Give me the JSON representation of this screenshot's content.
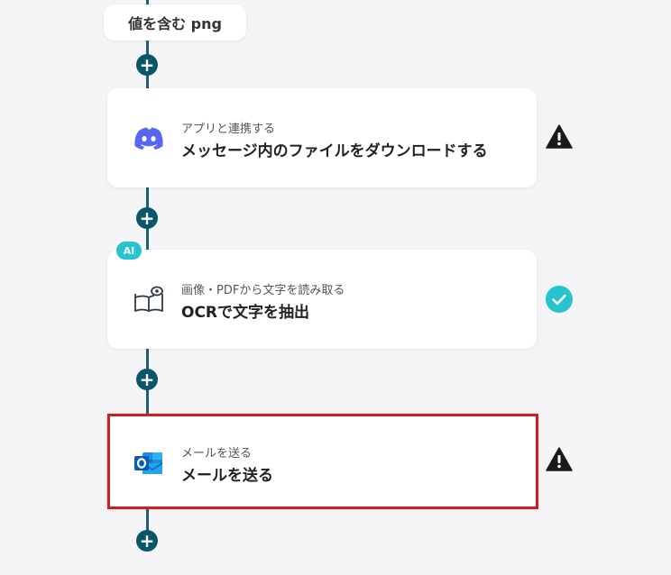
{
  "condition_pill": {
    "label": "値を含む png"
  },
  "steps": [
    {
      "subtitle": "アプリと連携する",
      "title": "メッセージ内のファイルをダウンロードする",
      "app_icon": "discord-icon",
      "status": "warning"
    },
    {
      "badge": "AI",
      "subtitle": "画像・PDFから文字を読み取る",
      "title": "OCRで文字を抽出",
      "app_icon": "ocr-book-eye-icon",
      "status": "success"
    },
    {
      "subtitle": "メールを送る",
      "title": "メールを送る",
      "app_icon": "outlook-icon",
      "status": "warning",
      "selected": true
    }
  ],
  "add_step_symbol": "+",
  "colors": {
    "connector": "#1c5f73",
    "plus_button": "#0b5669",
    "warning": "#1a1a1a",
    "success": "#27c3cf",
    "ai_badge": "#27c3cf",
    "selected_border": "#d91b1b",
    "discord": "#5865f2",
    "outlook": "#0a64c9"
  }
}
